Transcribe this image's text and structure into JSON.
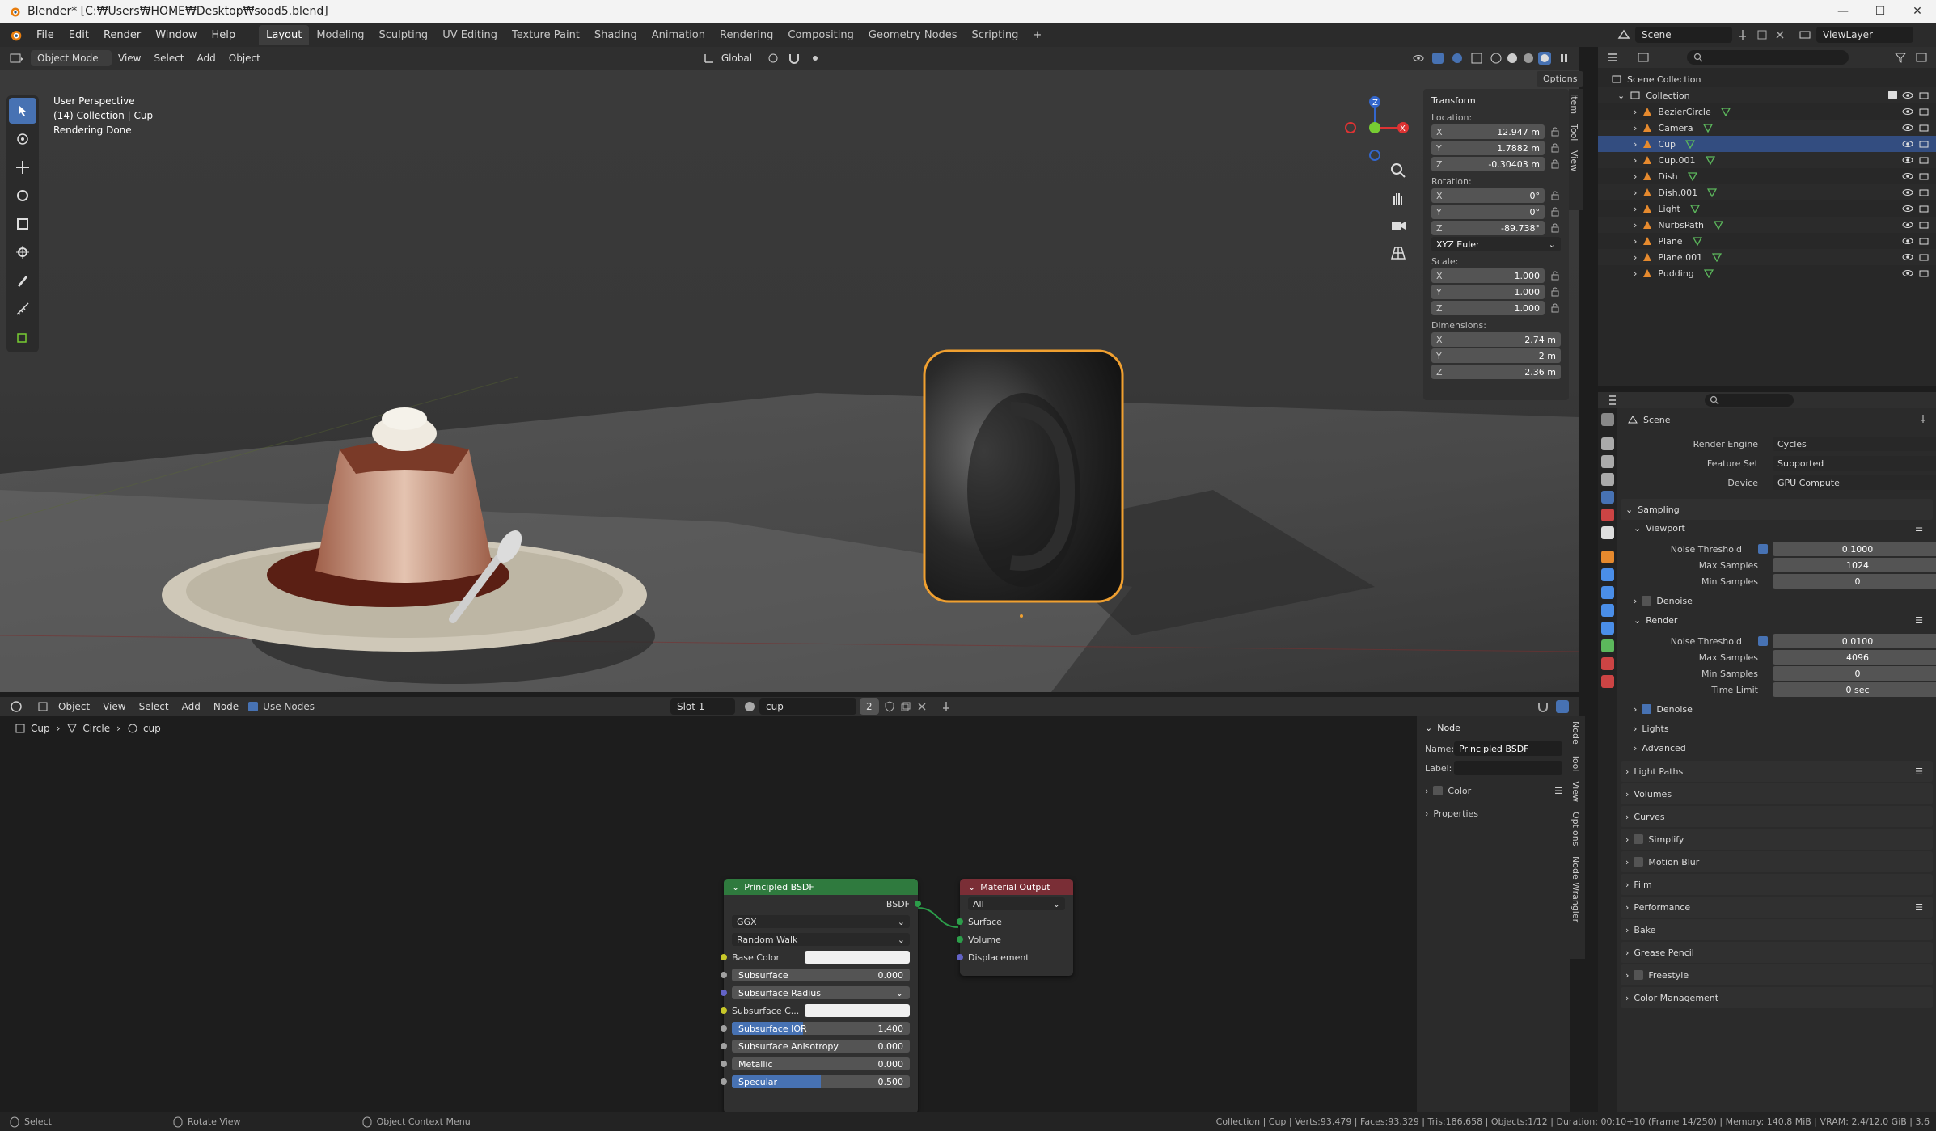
{
  "window": {
    "title": "Blender* [C:₩Users₩HOME₩Desktop₩sood5.blend]",
    "minimize": "—",
    "maximize": "☐",
    "close": "✕"
  },
  "menu": [
    "File",
    "Edit",
    "Render",
    "Window",
    "Help"
  ],
  "workspaces": [
    "Layout",
    "Modeling",
    "Sculpting",
    "UV Editing",
    "Texture Paint",
    "Shading",
    "Animation",
    "Rendering",
    "Compositing",
    "Geometry Nodes",
    "Scripting"
  ],
  "workspace_add": "+",
  "scene": {
    "name": "Scene",
    "view_layer": "ViewLayer"
  },
  "viewport": {
    "mode": "Object Mode",
    "menus": [
      "View",
      "Select",
      "Add",
      "Object"
    ],
    "orientation": "Global",
    "options": "Options",
    "info": [
      "User Perspective",
      "(14) Collection | Cup",
      "Rendering Done"
    ]
  },
  "transform": {
    "title": "Transform",
    "location_label": "Location:",
    "location": [
      {
        "axis": "X",
        "value": "12.947 m"
      },
      {
        "axis": "Y",
        "value": "1.7882 m"
      },
      {
        "axis": "Z",
        "value": "-0.30403 m"
      }
    ],
    "rotation_label": "Rotation:",
    "rotation": [
      {
        "axis": "X",
        "value": "0°"
      },
      {
        "axis": "Y",
        "value": "0°"
      },
      {
        "axis": "Z",
        "value": "-89.738°"
      }
    ],
    "rotation_mode": "XYZ Euler",
    "scale_label": "Scale:",
    "scale": [
      {
        "axis": "X",
        "value": "1.000"
      },
      {
        "axis": "Y",
        "value": "1.000"
      },
      {
        "axis": "Z",
        "value": "1.000"
      }
    ],
    "dimensions_label": "Dimensions:",
    "dimensions": [
      {
        "axis": "X",
        "value": "2.74 m"
      },
      {
        "axis": "Y",
        "value": "2 m"
      },
      {
        "axis": "Z",
        "value": "2.36 m"
      }
    ]
  },
  "vp_side_tabs": [
    "Item",
    "Tool",
    "View"
  ],
  "node_editor": {
    "object_type": "Object",
    "menus": [
      "View",
      "Select",
      "Add",
      "Node"
    ],
    "use_nodes": "Use Nodes",
    "slot": "Slot 1",
    "material": "cup",
    "users": "2",
    "breadcrumb": [
      "Cup",
      "Circle",
      "cup"
    ],
    "side_tabs": [
      "Node",
      "Tool",
      "View",
      "Options",
      "Node Wrangler"
    ]
  },
  "node_panel": {
    "title": "Node",
    "name_label": "Name:",
    "name": "Principled BSDF",
    "label_label": "Label:",
    "label": "",
    "color": "Color",
    "properties": "Properties"
  },
  "principled": {
    "title": "Principled BSDF",
    "output": "BSDF",
    "distribution": "GGX",
    "subsurface_method": "Random Walk",
    "rows": [
      {
        "label": "Base Color",
        "type": "color",
        "socket": "#c7c729"
      },
      {
        "label": "Subsurface",
        "type": "value",
        "value": "0.000",
        "fill": 0,
        "socket": "#a1a1a1"
      },
      {
        "label": "Subsurface Radius",
        "type": "dropdown",
        "socket": "#6363c7"
      },
      {
        "label": "Subsurface C...",
        "type": "color",
        "socket": "#c7c729"
      },
      {
        "label": "Subsurface IOR",
        "type": "value",
        "value": "1.400",
        "fill": 0.4,
        "socket": "#a1a1a1"
      },
      {
        "label": "Subsurface Anisotropy",
        "type": "value",
        "value": "0.000",
        "fill": 0,
        "socket": "#a1a1a1"
      },
      {
        "label": "Metallic",
        "type": "value",
        "value": "0.000",
        "fill": 0,
        "socket": "#a1a1a1"
      },
      {
        "label": "Specular",
        "type": "value",
        "value": "0.500",
        "fill": 0.5,
        "socket": "#a1a1a1"
      }
    ]
  },
  "material_output": {
    "title": "Material Output",
    "target": "All",
    "inputs": [
      "Surface",
      "Volume",
      "Displacement"
    ]
  },
  "outliner": {
    "scene_collection": "Scene Collection",
    "collection": "Collection",
    "objects": [
      "BezierCircle",
      "Camera",
      "Cup",
      "Cup.001",
      "Dish",
      "Dish.001",
      "Light",
      "NurbsPath",
      "Plane",
      "Plane.001",
      "Pudding"
    ],
    "selected": "Cup"
  },
  "properties": {
    "context": "Scene",
    "render_engine_label": "Render Engine",
    "render_engine": "Cycles",
    "feature_set_label": "Feature Set",
    "feature_set": "Supported",
    "device_label": "Device",
    "device": "GPU Compute",
    "sampling": "Sampling",
    "viewport": "Viewport",
    "vp_noise_label": "Noise Threshold",
    "vp_noise": "0.1000",
    "vp_max_label": "Max Samples",
    "vp_max": "1024",
    "vp_min_label": "Min Samples",
    "vp_min": "0",
    "vp_denoise": "Denoise",
    "render": "Render",
    "r_noise_label": "Noise Threshold",
    "r_noise": "0.0100",
    "r_max_label": "Max Samples",
    "r_max": "4096",
    "r_min_label": "Min Samples",
    "r_min": "0",
    "r_time_label": "Time Limit",
    "r_time": "0 sec",
    "r_denoise": "Denoise",
    "lights": "Lights",
    "advanced": "Advanced",
    "sections": [
      "Light Paths",
      "Volumes",
      "Curves",
      "Simplify",
      "Motion Blur",
      "Film",
      "Performance",
      "Bake",
      "Grease Pencil",
      "Freestyle",
      "Color Management"
    ]
  },
  "status": {
    "select": "Select",
    "rotate": "Rotate View",
    "context": "Object Context Menu",
    "stats": "Collection | Cup | Verts:93,479 | Faces:93,329 | Tris:186,658 | Objects:1/12 | Duration: 00:10+10 (Frame 14/250) | Memory: 140.8 MiB | VRAM: 2.4/12.0 GiB | 3.6"
  },
  "colors": {
    "accent": "#4772b3",
    "selection_outline": "#f0a030",
    "shader_header": "#2f7a3e",
    "output_header": "#7a2e36"
  }
}
